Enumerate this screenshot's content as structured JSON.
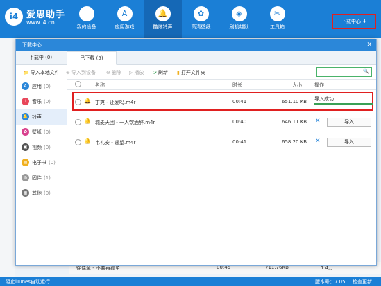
{
  "header": {
    "brand": "爱思助手",
    "url": "www.i4.cn",
    "nav": [
      {
        "label": "我的设备",
        "icon": "apple-icon"
      },
      {
        "label": "应用游戏",
        "icon": "app-store-icon"
      },
      {
        "label": "酷炫铃声",
        "icon": "bell-icon"
      },
      {
        "label": "高清壁纸",
        "icon": "flower-icon"
      },
      {
        "label": "刷机越狱",
        "icon": "dropbox-icon"
      },
      {
        "label": "工具箱",
        "icon": "tools-icon"
      }
    ],
    "download_center": "下载中心 ⬇"
  },
  "dialog": {
    "title": "下载中心",
    "close": "✕",
    "tabs": [
      "下载中 (0)",
      "已下载 (5)"
    ],
    "toolbar": {
      "import_local": "导入本地文件",
      "import_device": "导入到设备",
      "delete": "删除",
      "play": "播放",
      "refresh": "刷新",
      "open_folder": "打开文件夹"
    },
    "search_icon": "🔍",
    "categories": [
      {
        "label": "应用",
        "count": "(0)",
        "color": "#2b87d9",
        "glyph": "A"
      },
      {
        "label": "音乐",
        "count": "(0)",
        "color": "#e8465a",
        "glyph": "♪"
      },
      {
        "label": "铃声",
        "count": "",
        "color": "#2b87d9",
        "glyph": "🔔"
      },
      {
        "label": "壁纸",
        "count": "(0)",
        "color": "#d9418f",
        "glyph": "✿"
      },
      {
        "label": "视频",
        "count": "(0)",
        "color": "#555555",
        "glyph": "▣"
      },
      {
        "label": "电子书",
        "count": "(0)",
        "color": "#f0b020",
        "glyph": "▤"
      },
      {
        "label": "固件",
        "count": "(1)",
        "color": "#999999",
        "glyph": "◍"
      },
      {
        "label": "其他",
        "count": "(0)",
        "color": "#777777",
        "glyph": "▦"
      }
    ],
    "columns": {
      "name": "名称",
      "duration": "时长",
      "size": "大小",
      "action": "操作"
    },
    "rows": [
      {
        "name": "丁爽 - 还爱吗.m4r",
        "duration": "00:41",
        "size": "651.10 KB",
        "status": "导入成功",
        "import": ""
      },
      {
        "name": "城麦天团 - 一人饮酒醉.m4r",
        "duration": "00:40",
        "size": "646.11 KB",
        "status": "",
        "import": "导入"
      },
      {
        "name": "韦礼安 - 遥望.m4r",
        "duration": "00:41",
        "size": "658.20 KB",
        "status": "",
        "import": "导入"
      }
    ]
  },
  "background": {
    "song": "徐佳莹 - 不要再孤单",
    "duration": "00:45",
    "size": "711.76KB",
    "plays": "1.4万"
  },
  "statusbar": {
    "itunes": "阻止iTunes自动运行",
    "version": "版本号：7.05",
    "check_update": "检查更新"
  }
}
